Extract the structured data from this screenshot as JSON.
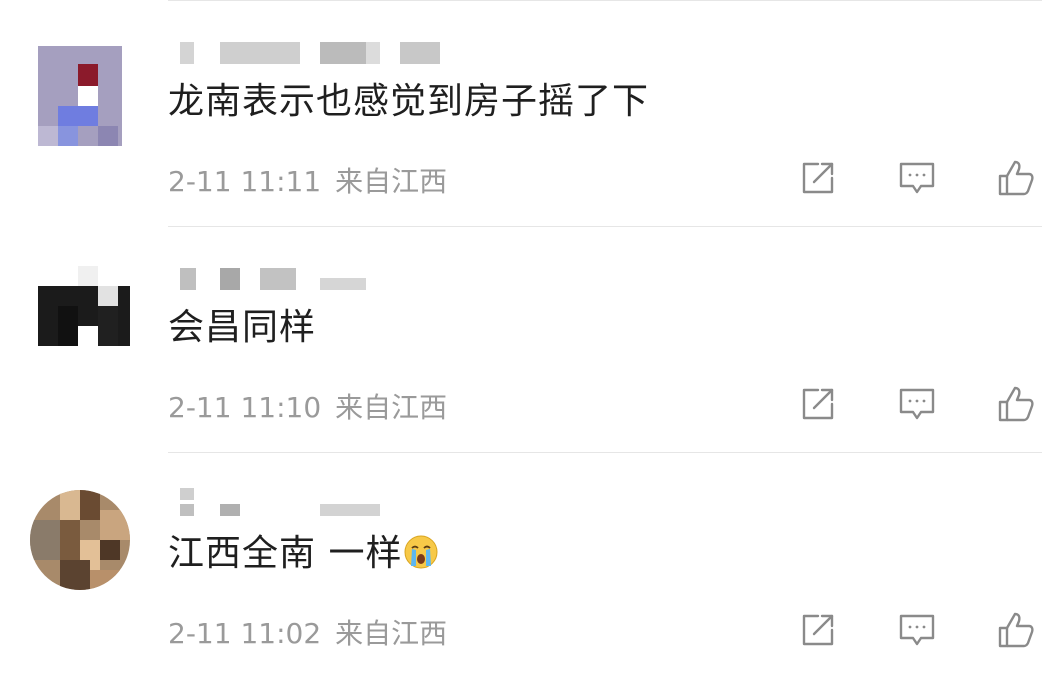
{
  "comments": [
    {
      "text": "龙南表示也感觉到房子摇了下",
      "time": "2-11 11:11",
      "location": "来自江西",
      "username": "",
      "actions": [
        "share-icon",
        "comment-icon",
        "like-icon"
      ]
    },
    {
      "text": "会昌同样",
      "time": "2-11 11:10",
      "location": "来自江西",
      "username": "",
      "actions": [
        "share-icon",
        "comment-icon",
        "like-icon"
      ]
    },
    {
      "text": "江西全南 一样",
      "emoji": "crying-face-emoji",
      "time": "2-11 11:02",
      "location": "来自江西",
      "username": "",
      "actions": [
        "share-icon",
        "comment-icon",
        "like-icon"
      ]
    }
  ],
  "colors": {
    "text": "#1f1f1f",
    "meta": "#9a9a9a",
    "icon": "#8a8a8a",
    "divider": "#e6e6e6"
  }
}
